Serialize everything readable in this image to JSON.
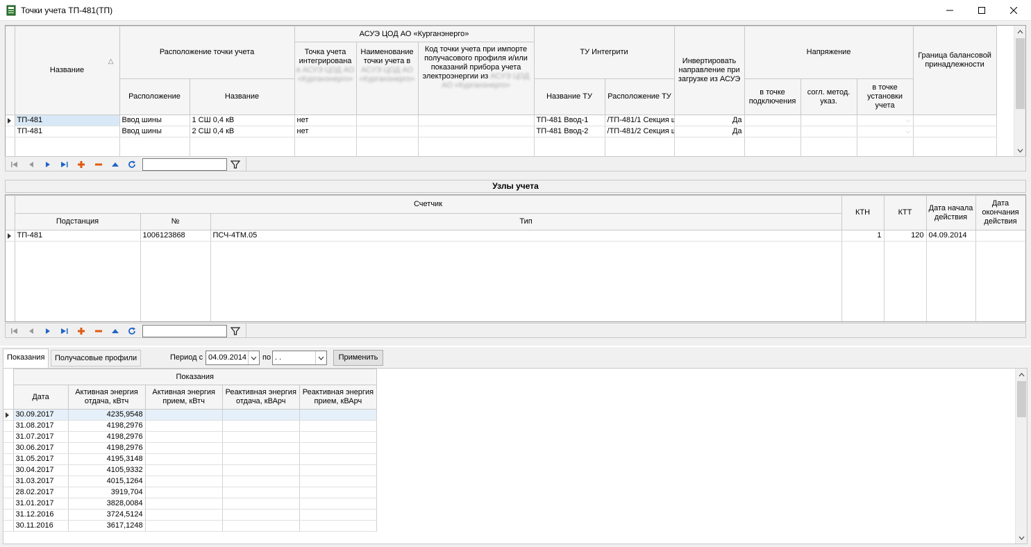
{
  "window": {
    "title": "Точки учета ТП-481(ТП)"
  },
  "points_table": {
    "headers": {
      "name": "Название",
      "location_group": "Расположение точки учета",
      "location": "Расположение",
      "location_name": "Название",
      "asue_group": "АСУЭ ЦОД АО «Курганэнерго»",
      "integrated": "Точка учета интегрирована",
      "integrated_blur": "в АСУЭ ЦОД АО «Курганэнерго»",
      "point_name": "Наименование точки учета в",
      "point_name_blur": "АСУЭ ЦОД АО «Курганэнерго»",
      "import_code": "Код точки учета при импорте получасового профиля и/или показаний прибора учета электроэнергии из",
      "import_code_blur": "АСУЭ ЦОД АО «Курганэнерго»",
      "tu_group": "ТУ Интегрити",
      "tu_name": "Название ТУ",
      "tu_location": "Расположение ТУ",
      "invert": "Инвертировать направление при загрузке из АСУЭ",
      "voltage_group": "Напряжение",
      "v_connection": "в точке подключения",
      "v_agreed": "согл. метод. указ.",
      "v_install": "в точке установки учета",
      "border": "Граница балансовой принадлежности"
    },
    "rows": [
      {
        "name": "ТП-481",
        "location": "Ввод шины",
        "location_name": "1 СШ 0,4 кВ",
        "integrated": "нет",
        "point_name": "",
        "import_code": "",
        "tu_name": "ТП-481 Ввод-1",
        "tu_location": "/ТП-481/1 Секция ш",
        "invert": "Да"
      },
      {
        "name": "ТП-481",
        "location": "Ввод шины",
        "location_name": "2 СШ 0,4 кВ",
        "integrated": "нет",
        "point_name": "",
        "import_code": "",
        "tu_name": "ТП-481 Ввод-2",
        "tu_location": "/ТП-481/2 Секция ш",
        "invert": "Да"
      }
    ]
  },
  "nodes_section": {
    "title": "Узлы учета",
    "headers": {
      "meter_group": "Счетчик",
      "substation": "Подстанция",
      "number": "№",
      "type": "Тип",
      "ktn": "КТН",
      "ktt": "КТТ",
      "start_date": "Дата начала действия",
      "end_date": "Дата окончания действия"
    },
    "rows": [
      {
        "substation": "ТП-481",
        "number": "1006123868",
        "type": "ПСЧ-4ТМ.05",
        "ktn": "1",
        "ktt": "120",
        "start_date": "04.09.2014",
        "end_date": ""
      }
    ]
  },
  "bottom": {
    "tabs": [
      "Показания",
      "Получасовые профили"
    ],
    "period_label": "Период с",
    "period_from": "04.09.2014",
    "period_to_label": "по",
    "period_to": ". .",
    "apply_label": "Применить",
    "readings": {
      "group_header": "Показания",
      "headers": [
        "Дата",
        "Активная энергия отдача, кВтч",
        "Активная энергия прием, кВтч",
        "Реактивная энергия отдача, кВАрч",
        "Реактивная энергия прием, кВАрч"
      ],
      "rows": [
        {
          "date": "30.09.2017",
          "active_out": "4235,9548"
        },
        {
          "date": "31.08.2017",
          "active_out": "4198,2976"
        },
        {
          "date": "31.07.2017",
          "active_out": "4198,2976"
        },
        {
          "date": "30.06.2017",
          "active_out": "4198,2976"
        },
        {
          "date": "31.05.2017",
          "active_out": "4195,3148"
        },
        {
          "date": "30.04.2017",
          "active_out": "4105,9332"
        },
        {
          "date": "31.03.2017",
          "active_out": "4015,1264"
        },
        {
          "date": "28.02.2017",
          "active_out": "3919,704"
        },
        {
          "date": "31.01.2017",
          "active_out": "3828,0084"
        },
        {
          "date": "31.12.2016",
          "active_out": "3724,5124"
        },
        {
          "date": "30.11.2016",
          "active_out": "3617,1248"
        }
      ]
    }
  },
  "icons": {
    "nav": [
      "first-icon",
      "prev-icon",
      "next-icon",
      "last-icon",
      "add-icon",
      "remove-icon",
      "move-up-icon",
      "refresh-icon",
      "filter-icon"
    ]
  }
}
